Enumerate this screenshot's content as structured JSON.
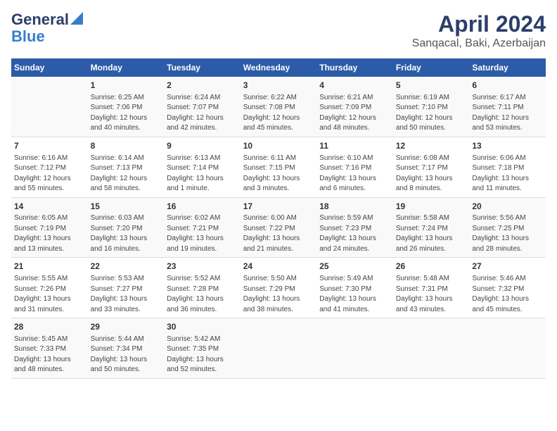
{
  "header": {
    "logo_line1": "General",
    "logo_line2": "Blue",
    "title": "April 2024",
    "subtitle": "Sanqacal, Baki, Azerbaijan"
  },
  "days_of_week": [
    "Sunday",
    "Monday",
    "Tuesday",
    "Wednesday",
    "Thursday",
    "Friday",
    "Saturday"
  ],
  "weeks": [
    [
      {
        "day": "",
        "content": ""
      },
      {
        "day": "1",
        "content": "Sunrise: 6:25 AM\nSunset: 7:06 PM\nDaylight: 12 hours\nand 40 minutes."
      },
      {
        "day": "2",
        "content": "Sunrise: 6:24 AM\nSunset: 7:07 PM\nDaylight: 12 hours\nand 42 minutes."
      },
      {
        "day": "3",
        "content": "Sunrise: 6:22 AM\nSunset: 7:08 PM\nDaylight: 12 hours\nand 45 minutes."
      },
      {
        "day": "4",
        "content": "Sunrise: 6:21 AM\nSunset: 7:09 PM\nDaylight: 12 hours\nand 48 minutes."
      },
      {
        "day": "5",
        "content": "Sunrise: 6:19 AM\nSunset: 7:10 PM\nDaylight: 12 hours\nand 50 minutes."
      },
      {
        "day": "6",
        "content": "Sunrise: 6:17 AM\nSunset: 7:11 PM\nDaylight: 12 hours\nand 53 minutes."
      }
    ],
    [
      {
        "day": "7",
        "content": "Sunrise: 6:16 AM\nSunset: 7:12 PM\nDaylight: 12 hours\nand 55 minutes."
      },
      {
        "day": "8",
        "content": "Sunrise: 6:14 AM\nSunset: 7:13 PM\nDaylight: 12 hours\nand 58 minutes."
      },
      {
        "day": "9",
        "content": "Sunrise: 6:13 AM\nSunset: 7:14 PM\nDaylight: 13 hours\nand 1 minute."
      },
      {
        "day": "10",
        "content": "Sunrise: 6:11 AM\nSunset: 7:15 PM\nDaylight: 13 hours\nand 3 minutes."
      },
      {
        "day": "11",
        "content": "Sunrise: 6:10 AM\nSunset: 7:16 PM\nDaylight: 13 hours\nand 6 minutes."
      },
      {
        "day": "12",
        "content": "Sunrise: 6:08 AM\nSunset: 7:17 PM\nDaylight: 13 hours\nand 8 minutes."
      },
      {
        "day": "13",
        "content": "Sunrise: 6:06 AM\nSunset: 7:18 PM\nDaylight: 13 hours\nand 11 minutes."
      }
    ],
    [
      {
        "day": "14",
        "content": "Sunrise: 6:05 AM\nSunset: 7:19 PM\nDaylight: 13 hours\nand 13 minutes."
      },
      {
        "day": "15",
        "content": "Sunrise: 6:03 AM\nSunset: 7:20 PM\nDaylight: 13 hours\nand 16 minutes."
      },
      {
        "day": "16",
        "content": "Sunrise: 6:02 AM\nSunset: 7:21 PM\nDaylight: 13 hours\nand 19 minutes."
      },
      {
        "day": "17",
        "content": "Sunrise: 6:00 AM\nSunset: 7:22 PM\nDaylight: 13 hours\nand 21 minutes."
      },
      {
        "day": "18",
        "content": "Sunrise: 5:59 AM\nSunset: 7:23 PM\nDaylight: 13 hours\nand 24 minutes."
      },
      {
        "day": "19",
        "content": "Sunrise: 5:58 AM\nSunset: 7:24 PM\nDaylight: 13 hours\nand 26 minutes."
      },
      {
        "day": "20",
        "content": "Sunrise: 5:56 AM\nSunset: 7:25 PM\nDaylight: 13 hours\nand 28 minutes."
      }
    ],
    [
      {
        "day": "21",
        "content": "Sunrise: 5:55 AM\nSunset: 7:26 PM\nDaylight: 13 hours\nand 31 minutes."
      },
      {
        "day": "22",
        "content": "Sunrise: 5:53 AM\nSunset: 7:27 PM\nDaylight: 13 hours\nand 33 minutes."
      },
      {
        "day": "23",
        "content": "Sunrise: 5:52 AM\nSunset: 7:28 PM\nDaylight: 13 hours\nand 36 minutes."
      },
      {
        "day": "24",
        "content": "Sunrise: 5:50 AM\nSunset: 7:29 PM\nDaylight: 13 hours\nand 38 minutes."
      },
      {
        "day": "25",
        "content": "Sunrise: 5:49 AM\nSunset: 7:30 PM\nDaylight: 13 hours\nand 41 minutes."
      },
      {
        "day": "26",
        "content": "Sunrise: 5:48 AM\nSunset: 7:31 PM\nDaylight: 13 hours\nand 43 minutes."
      },
      {
        "day": "27",
        "content": "Sunrise: 5:46 AM\nSunset: 7:32 PM\nDaylight: 13 hours\nand 45 minutes."
      }
    ],
    [
      {
        "day": "28",
        "content": "Sunrise: 5:45 AM\nSunset: 7:33 PM\nDaylight: 13 hours\nand 48 minutes."
      },
      {
        "day": "29",
        "content": "Sunrise: 5:44 AM\nSunset: 7:34 PM\nDaylight: 13 hours\nand 50 minutes."
      },
      {
        "day": "30",
        "content": "Sunrise: 5:42 AM\nSunset: 7:35 PM\nDaylight: 13 hours\nand 52 minutes."
      },
      {
        "day": "",
        "content": ""
      },
      {
        "day": "",
        "content": ""
      },
      {
        "day": "",
        "content": ""
      },
      {
        "day": "",
        "content": ""
      }
    ]
  ]
}
